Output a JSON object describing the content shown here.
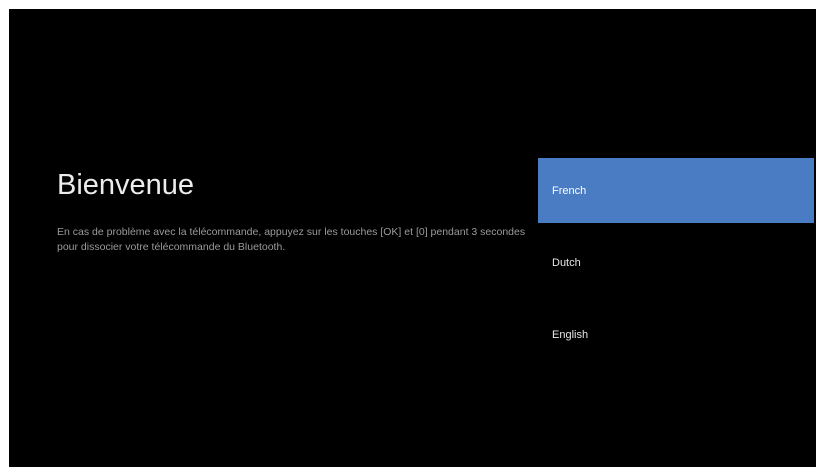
{
  "welcome": {
    "title": "Bienvenue",
    "description": "En cas de problème avec la télécommande, appuyez sur les touches [OK] et [0] pendant 3 secondes pour dissocier votre télécommande du Bluetooth."
  },
  "languages": {
    "selected": "French",
    "items": [
      {
        "label": "French"
      },
      {
        "label": "Dutch"
      },
      {
        "label": "English"
      }
    ]
  },
  "colors": {
    "background": "#000000",
    "selection": "#4a7cc4",
    "title_text": "#ececec",
    "body_text": "#9a9a9a",
    "logo": "#6a3db8"
  }
}
